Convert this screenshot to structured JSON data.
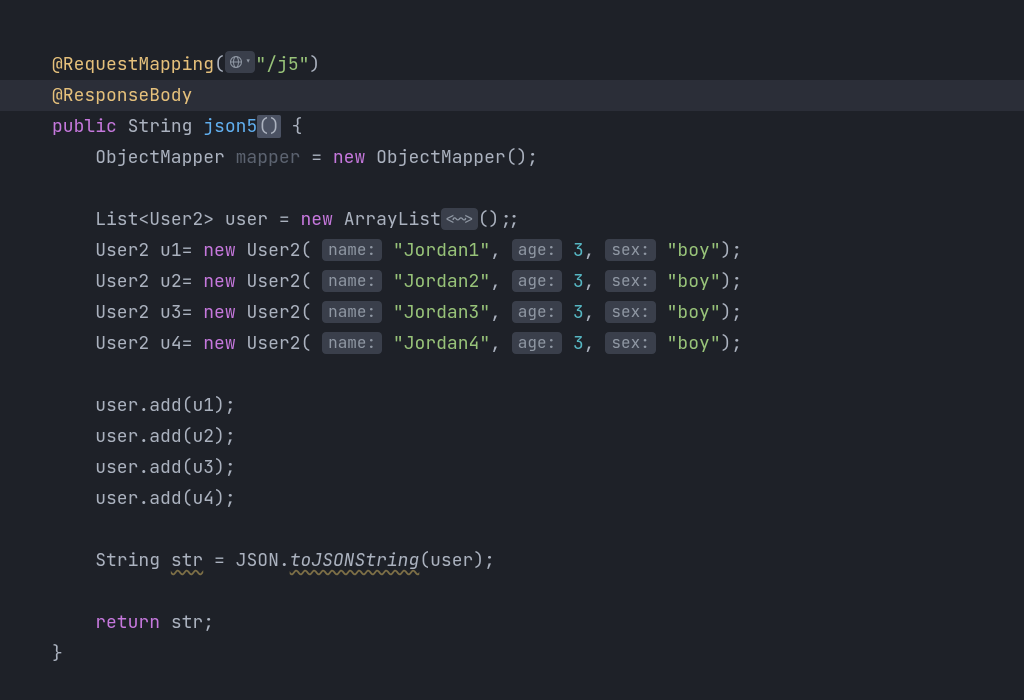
{
  "code": {
    "ann_request_mapping": "@RequestMapping",
    "url_path": "\"/j5\"",
    "ann_response_body": "@ResponseBody",
    "kw_public": "public",
    "kw_new": "new",
    "kw_return": "return",
    "type_string": "String",
    "method_name": "json5",
    "type_object_mapper": "ObjectMapper",
    "var_mapper": "mapper",
    "type_list": "List",
    "type_user2": "User2",
    "var_user": "user",
    "type_arraylist": "ArrayList",
    "diamond_hint": "<~>",
    "u1": {
      "var": "u1",
      "name_val": "\"Jordan1\"",
      "age_val": "3",
      "sex_val": "\"boy\""
    },
    "u2": {
      "var": "u2",
      "name_val": "\"Jordan2\"",
      "age_val": "3",
      "sex_val": "\"boy\""
    },
    "u3": {
      "var": "u3",
      "name_val": "\"Jordan3\"",
      "age_val": "3",
      "sex_val": "\"boy\""
    },
    "u4": {
      "var": "u4",
      "name_val": "\"Jordan4\"",
      "age_val": "3",
      "sex_val": "\"boy\""
    },
    "hint_name": "name:",
    "hint_age": "age:",
    "hint_sex": "sex:",
    "method_add": "add",
    "var_str": "str",
    "type_json": "JSON",
    "method_tojson": "toJSONString"
  }
}
